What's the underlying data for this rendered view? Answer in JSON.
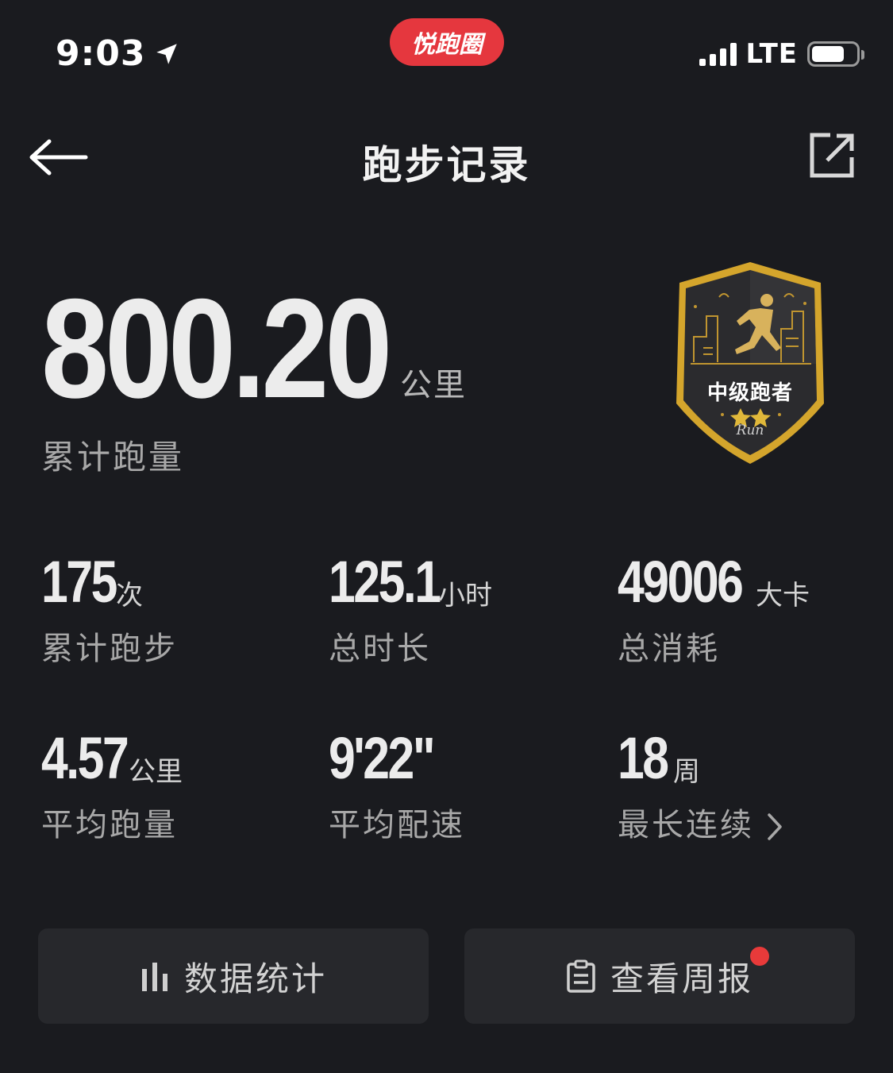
{
  "status_bar": {
    "time": "9:03",
    "app_pill": "悦跑圈",
    "network": "LTE"
  },
  "nav": {
    "title": "跑步记录"
  },
  "hero": {
    "value": "800.20",
    "unit": "公里",
    "label": "累计跑量"
  },
  "badge": {
    "title": "中级跑者",
    "stars": "★★",
    "script": "Run",
    "colors": {
      "gold": "#d4a52c",
      "fill": "#2b2b2e"
    }
  },
  "stats": [
    {
      "value": "175",
      "unit": "次",
      "label": "累计跑步"
    },
    {
      "value": "125.1",
      "unit": "小时",
      "label": "总时长"
    },
    {
      "value": "49006",
      "unit": "大卡",
      "label": "总消耗"
    },
    {
      "value": "4.57",
      "unit": "公里",
      "label": "平均跑量"
    },
    {
      "value": "9'22\"",
      "unit": "",
      "label": "平均配速"
    },
    {
      "value": "18",
      "unit": "周",
      "label": "最长连续"
    }
  ],
  "buttons": {
    "stats_label": "数据统计",
    "weekly_label": "查看周报"
  },
  "colors": {
    "background": "#1a1b1f",
    "button_bg": "#27282c",
    "accent_red": "#e5373e"
  },
  "icons": {
    "back": "arrow-left-icon",
    "share": "share-icon",
    "stats": "bar-chart-icon",
    "report": "clipboard-icon"
  }
}
